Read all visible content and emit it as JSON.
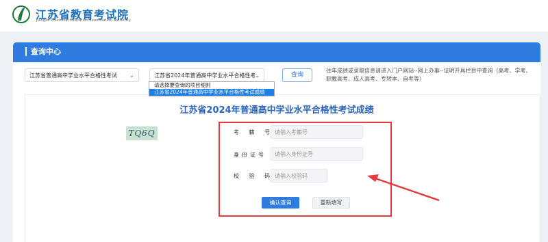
{
  "header": {
    "title": "江苏省教育考试院",
    "subtitle": "Jiangsu Provincial Education Examination Authority"
  },
  "panel": {
    "title": "查询中心"
  },
  "filters": {
    "category_select": "江苏省普通高中学业水平合格性考试",
    "project_select": "江苏省2024年普通高中学业水平合格性考",
    "dropdown_options": [
      "请选择要查询的项目细则",
      "江苏省2024年普通高中学业水平合格性考试成绩"
    ],
    "query_button": "查询",
    "notice": "往年成绩或录取信息请进入门户网站--网上办事--证明开具栏目中查询（高考、学考、职教高考、成人高考、专转本、自考等）"
  },
  "result": {
    "title": "江苏省2024年普通高中学业水平合格性考试成绩",
    "fields": {
      "exam_no_label": "考 籍 号",
      "exam_no_placeholder": "请输入考籍号",
      "id_label": "身份证号",
      "id_placeholder": "请输入身份证号",
      "captcha_label": "校 验 码",
      "captcha_placeholder": "请输入校验码",
      "captcha_text": "TQ6Q"
    },
    "confirm_button": "确认查询",
    "reset_button": "重新填写"
  },
  "colors": {
    "accent": "#2f7be0",
    "highlight_border": "#e23b3b",
    "title_blue": "#2b63b8"
  }
}
